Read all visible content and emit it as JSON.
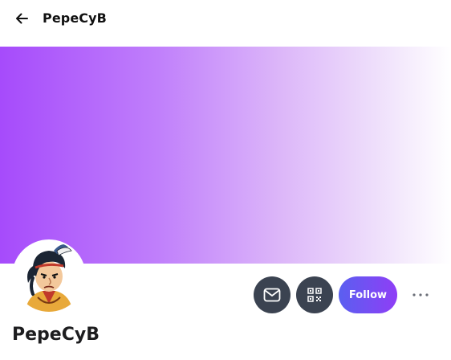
{
  "header": {
    "back_icon": "arrow-left-icon",
    "title": "PepeCyB"
  },
  "banner": {
    "colors": [
      "#a64bfb",
      "#dcb6f9",
      "#ffffff"
    ]
  },
  "profile": {
    "name": "PepeCyB",
    "avatar": "cartoon-avatar"
  },
  "actions": {
    "message_icon": "envelope-icon",
    "qr_icon": "qr-code-icon",
    "follow_label": "Follow",
    "more_icon": "more-horizontal-icon"
  },
  "colors": {
    "accent_start": "#5a5ff0",
    "accent_end": "#8f3ef6",
    "icon_button_bg": "#3b4351"
  }
}
